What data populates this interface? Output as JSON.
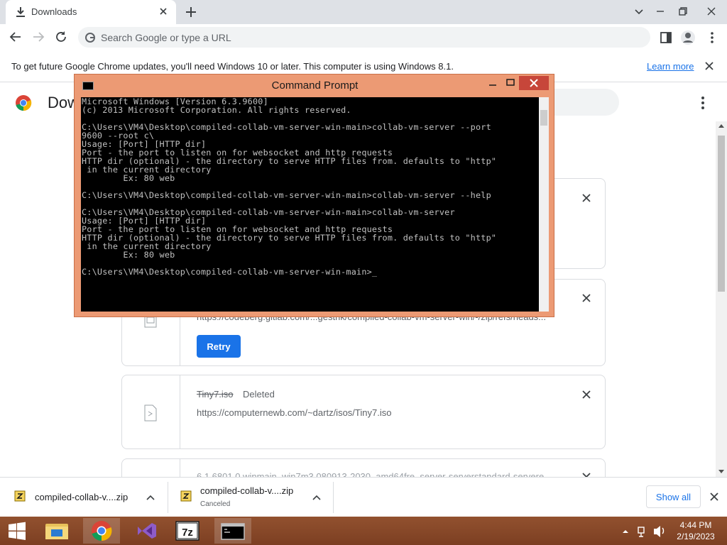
{
  "browser": {
    "tab": {
      "title": "Downloads"
    },
    "omnibox": {
      "placeholder": "Search Google or type a URL"
    },
    "infobar": {
      "message": "To get future Google Chrome updates, you'll need Windows 10 or later. This computer is using Windows 8.1.",
      "link": "Learn more"
    }
  },
  "downloads_page": {
    "title": "Dow",
    "cards": [
      {
        "name": "",
        "status": "",
        "url": ""
      },
      {
        "name": "",
        "status": "",
        "url": "https://codeberg.gitlab.com/...gestrik/compiled-collab-vm-server-win/-/zip/refs/heads...",
        "button": "Retry"
      },
      {
        "name": "Tiny7.iso",
        "status": "Deleted",
        "url": "https://computernewb.com/~dartz/isos/Tiny7.iso"
      },
      {
        "name": "",
        "status": "",
        "url": "6.1.6801.0.winmain_win7m3.080913-2030_amd64fre_server-serverstandard-servere..."
      }
    ]
  },
  "cmd_window": {
    "title": "Command Prompt",
    "console_text": "Microsoft Windows [Version 6.3.9600]\n(c) 2013 Microsoft Corporation. All rights reserved.\n\nC:\\Users\\VM4\\Desktop\\compiled-collab-vm-server-win-main>collab-vm-server --port\n9600 --root c\\\nUsage: [Port] [HTTP dir]\nPort - the port to listen on for websocket and http requests\nHTTP dir (optional) - the directory to serve HTTP files from. defaults to \"http\"\n in the current directory\n        Ex: 80 web\n\nC:\\Users\\VM4\\Desktop\\compiled-collab-vm-server-win-main>collab-vm-server --help\n\nC:\\Users\\VM4\\Desktop\\compiled-collab-vm-server-win-main>collab-vm-server\nUsage: [Port] [HTTP dir]\nPort - the port to listen on for websocket and http requests\nHTTP dir (optional) - the directory to serve HTTP files from. defaults to \"http\"\n in the current directory\n        Ex: 80 web\n\nC:\\Users\\VM4\\Desktop\\compiled-collab-vm-server-win-main>_"
  },
  "shelf": {
    "items": [
      {
        "name": "compiled-collab-v....zip",
        "status": ""
      },
      {
        "name": "compiled-collab-v....zip",
        "status": "Canceled"
      }
    ],
    "show_all": "Show all"
  },
  "taskbar": {
    "apps": [
      "file-explorer",
      "chrome",
      "visual-studio",
      "7-zip",
      "command-prompt"
    ],
    "clock": {
      "time": "4:44 PM",
      "date": "2/19/2023"
    }
  },
  "colors": {
    "accent": "#1a73e8",
    "cmd_frame": "#ec9a74",
    "taskbar": "#8a4a2a"
  }
}
